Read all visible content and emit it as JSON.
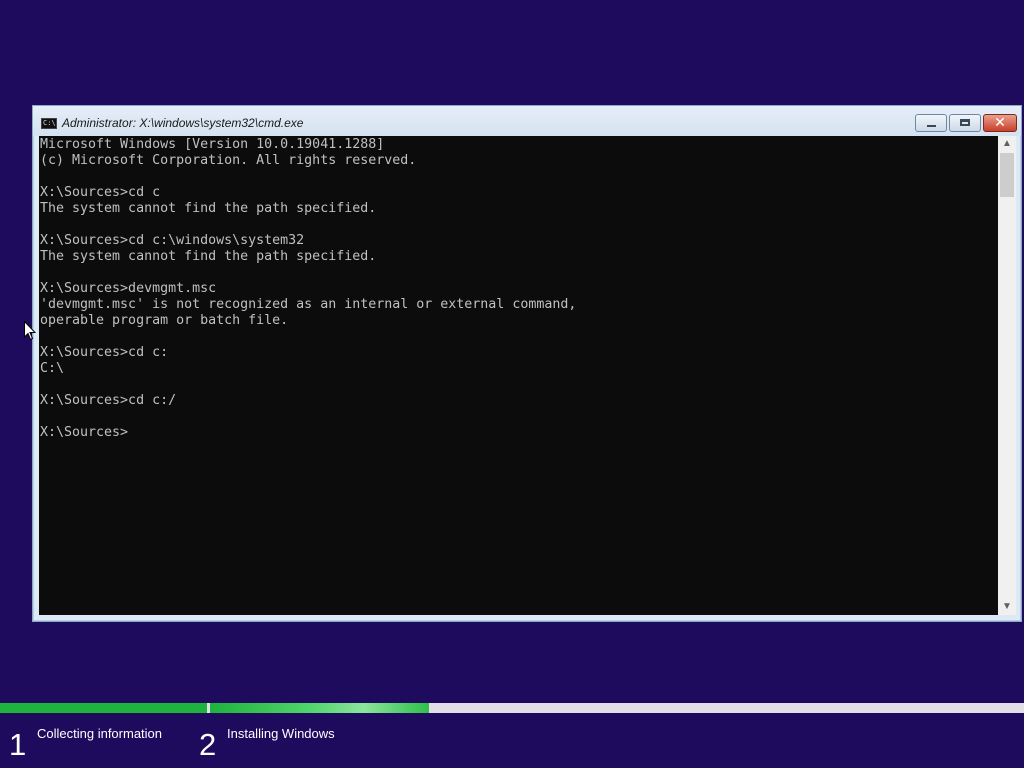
{
  "window": {
    "title": "Administrator: X:\\windows\\system32\\cmd.exe",
    "icon": "console-icon",
    "icon_text": "C:\\",
    "controls": {
      "minimize": "minimize-icon",
      "maximize": "maximize-icon",
      "close_glyph": "✕"
    }
  },
  "console": {
    "text": "Microsoft Windows [Version 10.0.19041.1288]\n(c) Microsoft Corporation. All rights reserved.\n\nX:\\Sources>cd c\nThe system cannot find the path specified.\n\nX:\\Sources>cd c:\\windows\\system32\nThe system cannot find the path specified.\n\nX:\\Sources>devmgmt.msc\n'devmgmt.msc' is not recognized as an internal or external command,\noperable program or batch file.\n\nX:\\Sources>cd c:\nC:\\\n\nX:\\Sources>cd c:/\n\nX:\\Sources>",
    "fg_color": "#c0c0c0",
    "bg_color": "#0c0c0c"
  },
  "scrollbar": {
    "up_glyph": "▲",
    "down_glyph": "▼"
  },
  "setup": {
    "steps": [
      {
        "number": "1",
        "label": "Collecting information"
      },
      {
        "number": "2",
        "label": "Installing Windows"
      }
    ],
    "progress": {
      "step1_fraction": 1.0,
      "step2_fraction": 1.0,
      "color": "#1eb33c"
    }
  },
  "colors": {
    "background": "#1f0b5e",
    "accent": "#1eb33c"
  }
}
